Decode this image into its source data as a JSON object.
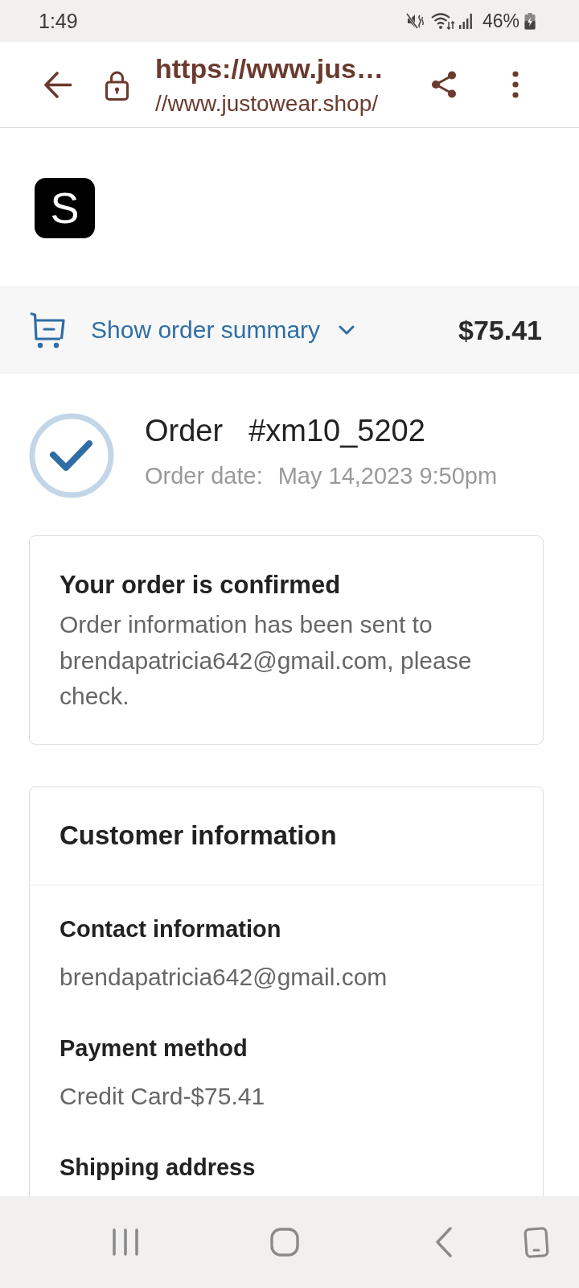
{
  "status_bar": {
    "time": "1:49",
    "battery": "46%"
  },
  "browser_bar": {
    "title": "https://www.jus…",
    "url": "//www.justowear.shop/"
  },
  "logo": {
    "text": "S"
  },
  "summary_bar": {
    "label": "Show order summary",
    "expanded": false,
    "total": "$75.41"
  },
  "order": {
    "label": "Order",
    "number": "#xm10_5202",
    "date_label": "Order date:",
    "date": "May 14,2023 9:50pm"
  },
  "confirmation_card": {
    "title": "Your order is confirmed",
    "message": "Order information has been sent to brendapatricia642@gmail.com, please check."
  },
  "customer_information": {
    "title": "Customer information",
    "sections": [
      {
        "heading": "Contact information",
        "value": "brendapatricia642@gmail.com"
      },
      {
        "heading": "Payment method",
        "value": "Credit Card-$75.41"
      },
      {
        "heading": "Shipping address"
      }
    ]
  }
}
